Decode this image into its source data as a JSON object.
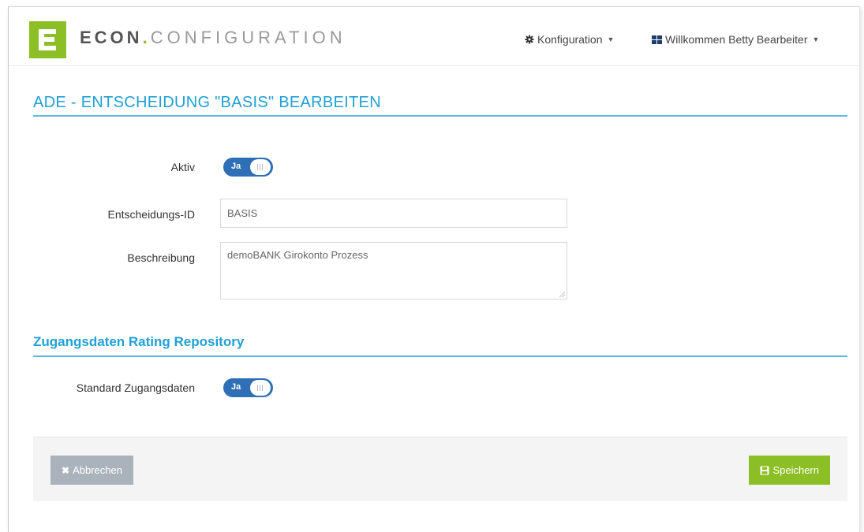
{
  "app": {
    "brand_part1": "ECON",
    "brand_dot": ".",
    "brand_part2": "CONFIGURATION",
    "logo_icon": "econ-logo"
  },
  "nav": {
    "config_label": "Konfiguration",
    "user_label": "Willkommen Betty Bearbeiter",
    "config_icon": "gear-icon",
    "user_icon": "grid-icon"
  },
  "page": {
    "title": "ADE - ENTSCHEIDUNG \"BASIS\" BEARBEITEN"
  },
  "form": {
    "aktiv_label": "Aktiv",
    "aktiv_toggle": "Ja",
    "aktiv_on": true,
    "id_label": "Entscheidungs-ID",
    "id_value": "BASIS",
    "desc_label": "Beschreibung",
    "desc_value": "demoBANK Girokonto Prozess"
  },
  "repository": {
    "section_title": "Zugangsdaten Rating Repository",
    "standard_label": "Standard Zugangsdaten",
    "standard_toggle": "Ja",
    "standard_on": true
  },
  "footer": {
    "cancel_label": "Abbrechen",
    "save_label": "Speichern",
    "cancel_icon": "close-icon",
    "save_icon": "floppy-disk-icon"
  },
  "colors": {
    "accent_blue": "#1fa0d6",
    "brand_green": "#8cbf26",
    "toggle_blue": "#2f6fb5",
    "cancel_gray": "#aab3bc"
  }
}
